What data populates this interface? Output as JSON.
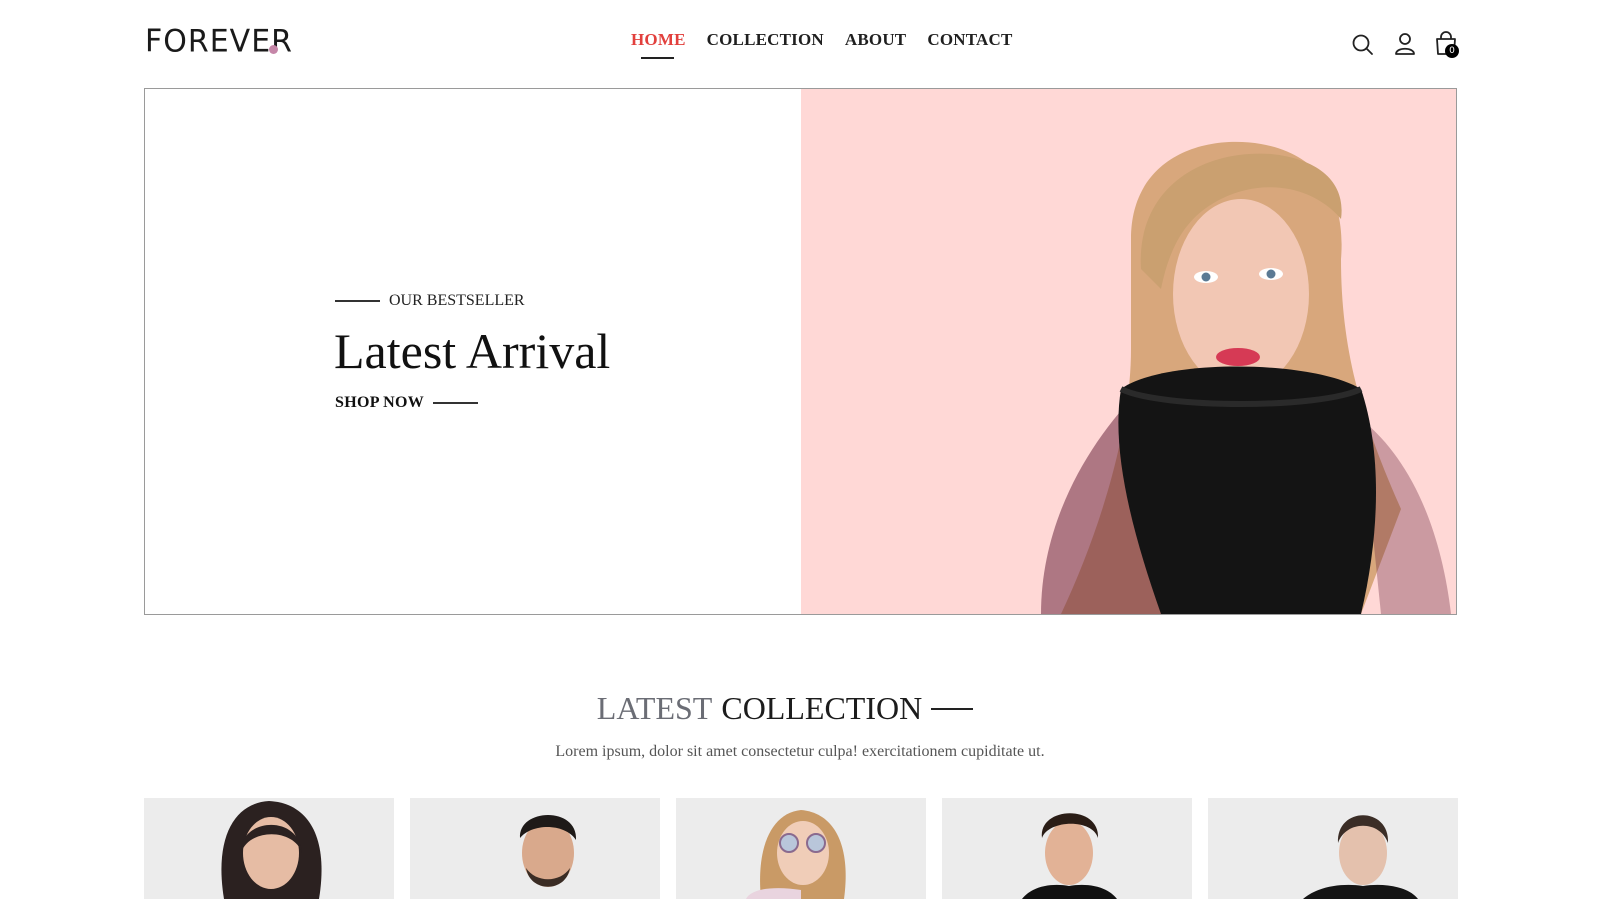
{
  "brand": {
    "name": "FOREVER",
    "dot_color": "#c586a8"
  },
  "nav": {
    "items": [
      "HOME",
      "COLLECTION",
      "ABOUT",
      "CONTACT"
    ],
    "active_index": 0,
    "active_color": "#e2403d"
  },
  "header_icons": {
    "search": "search-icon",
    "profile": "user-icon",
    "cart": "shopping-bag-icon",
    "cart_count": "0"
  },
  "hero": {
    "eyebrow": "OUR BESTSELLER",
    "title": "Latest Arrival",
    "cta": "SHOP NOW",
    "image_bg": "#ffd8d6"
  },
  "collection": {
    "title_muted": "LATEST",
    "title_strong": "COLLECTION",
    "subtitle": "Lorem ipsum, dolor sit amet consectetur culpa! exercitationem cupiditate ut."
  },
  "products": [
    {
      "id": "product-1"
    },
    {
      "id": "product-2"
    },
    {
      "id": "product-3"
    },
    {
      "id": "product-4"
    },
    {
      "id": "product-5"
    }
  ]
}
